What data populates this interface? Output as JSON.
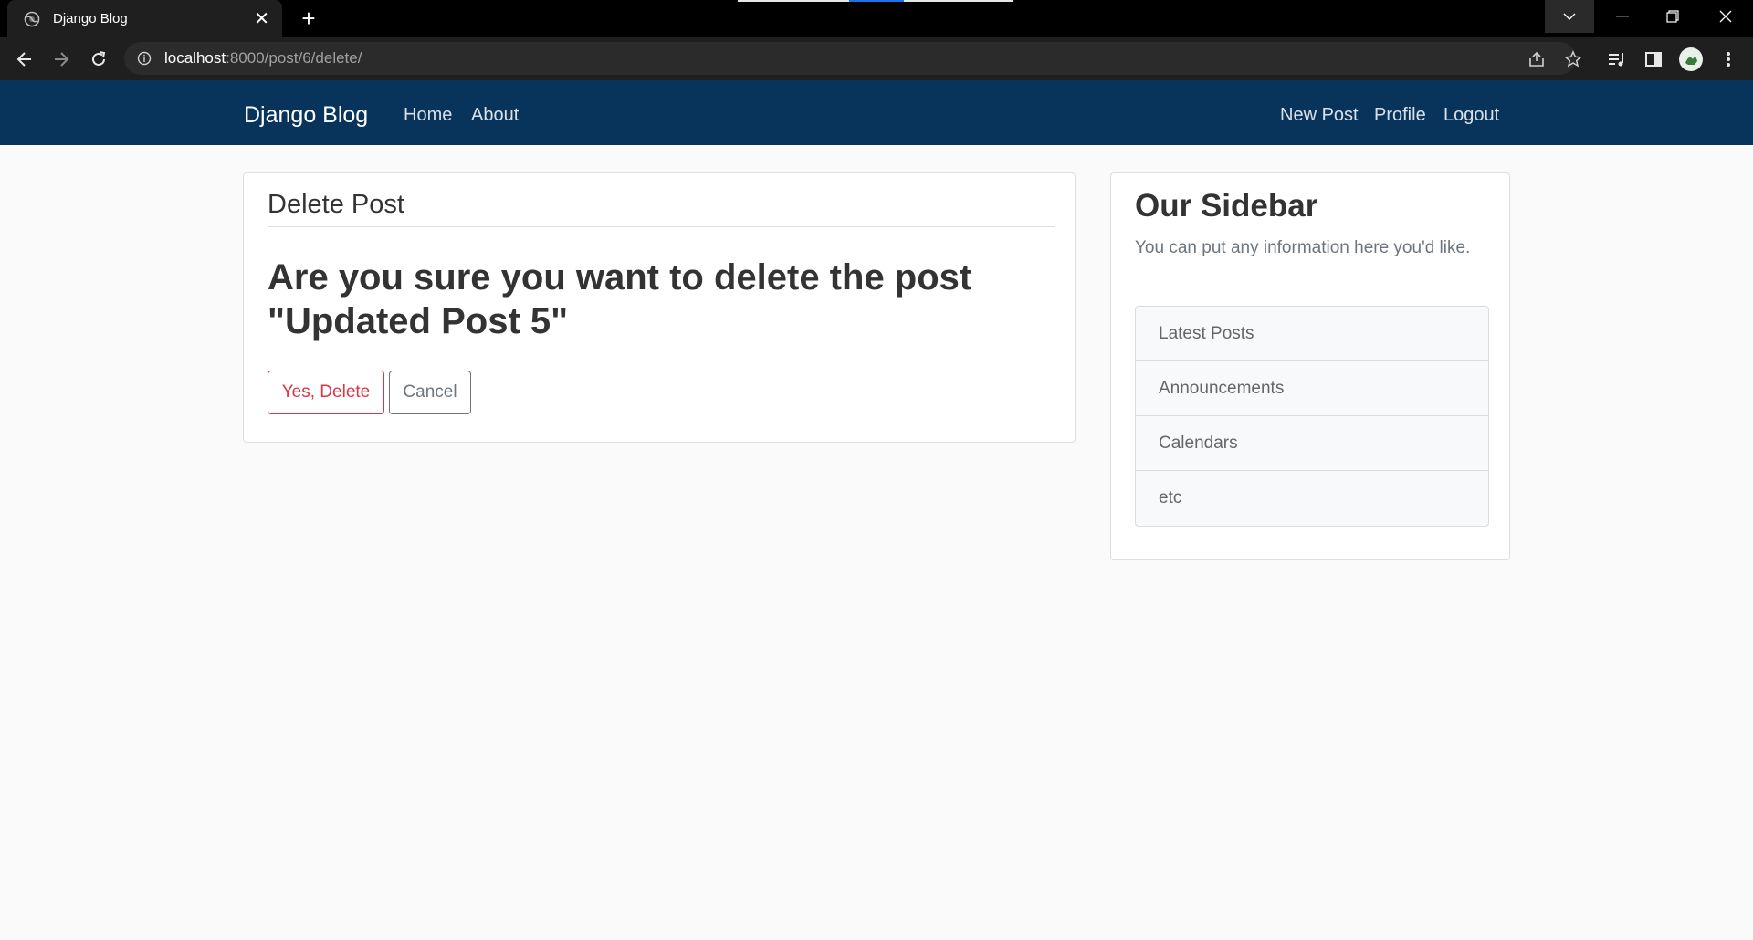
{
  "browser": {
    "tab_title": "Django Blog",
    "url_host": "localhost",
    "url_rest": ":8000/post/6/delete/"
  },
  "navbar": {
    "brand": "Django Blog",
    "left_links": [
      "Home",
      "About"
    ],
    "right_links": [
      "New Post",
      "Profile",
      "Logout"
    ],
    "bg_color": "#08345c"
  },
  "main": {
    "legend": "Delete Post",
    "confirm_text": "Are you sure you want to delete the post \"Updated Post 5\"",
    "confirm_button": "Yes, Delete",
    "cancel_button": "Cancel",
    "danger_color": "#dc3545"
  },
  "sidebar": {
    "title": "Our Sidebar",
    "text": "You can put any information here you'd like.",
    "items": [
      "Latest Posts",
      "Announcements",
      "Calendars",
      "etc"
    ]
  },
  "icons": [
    "globe-icon",
    "close-icon",
    "plus-icon",
    "back-icon",
    "forward-icon",
    "reload-icon",
    "info-icon",
    "share-icon",
    "star-icon",
    "media-icon",
    "sidepanel-icon",
    "avatar",
    "menu-icon"
  ]
}
